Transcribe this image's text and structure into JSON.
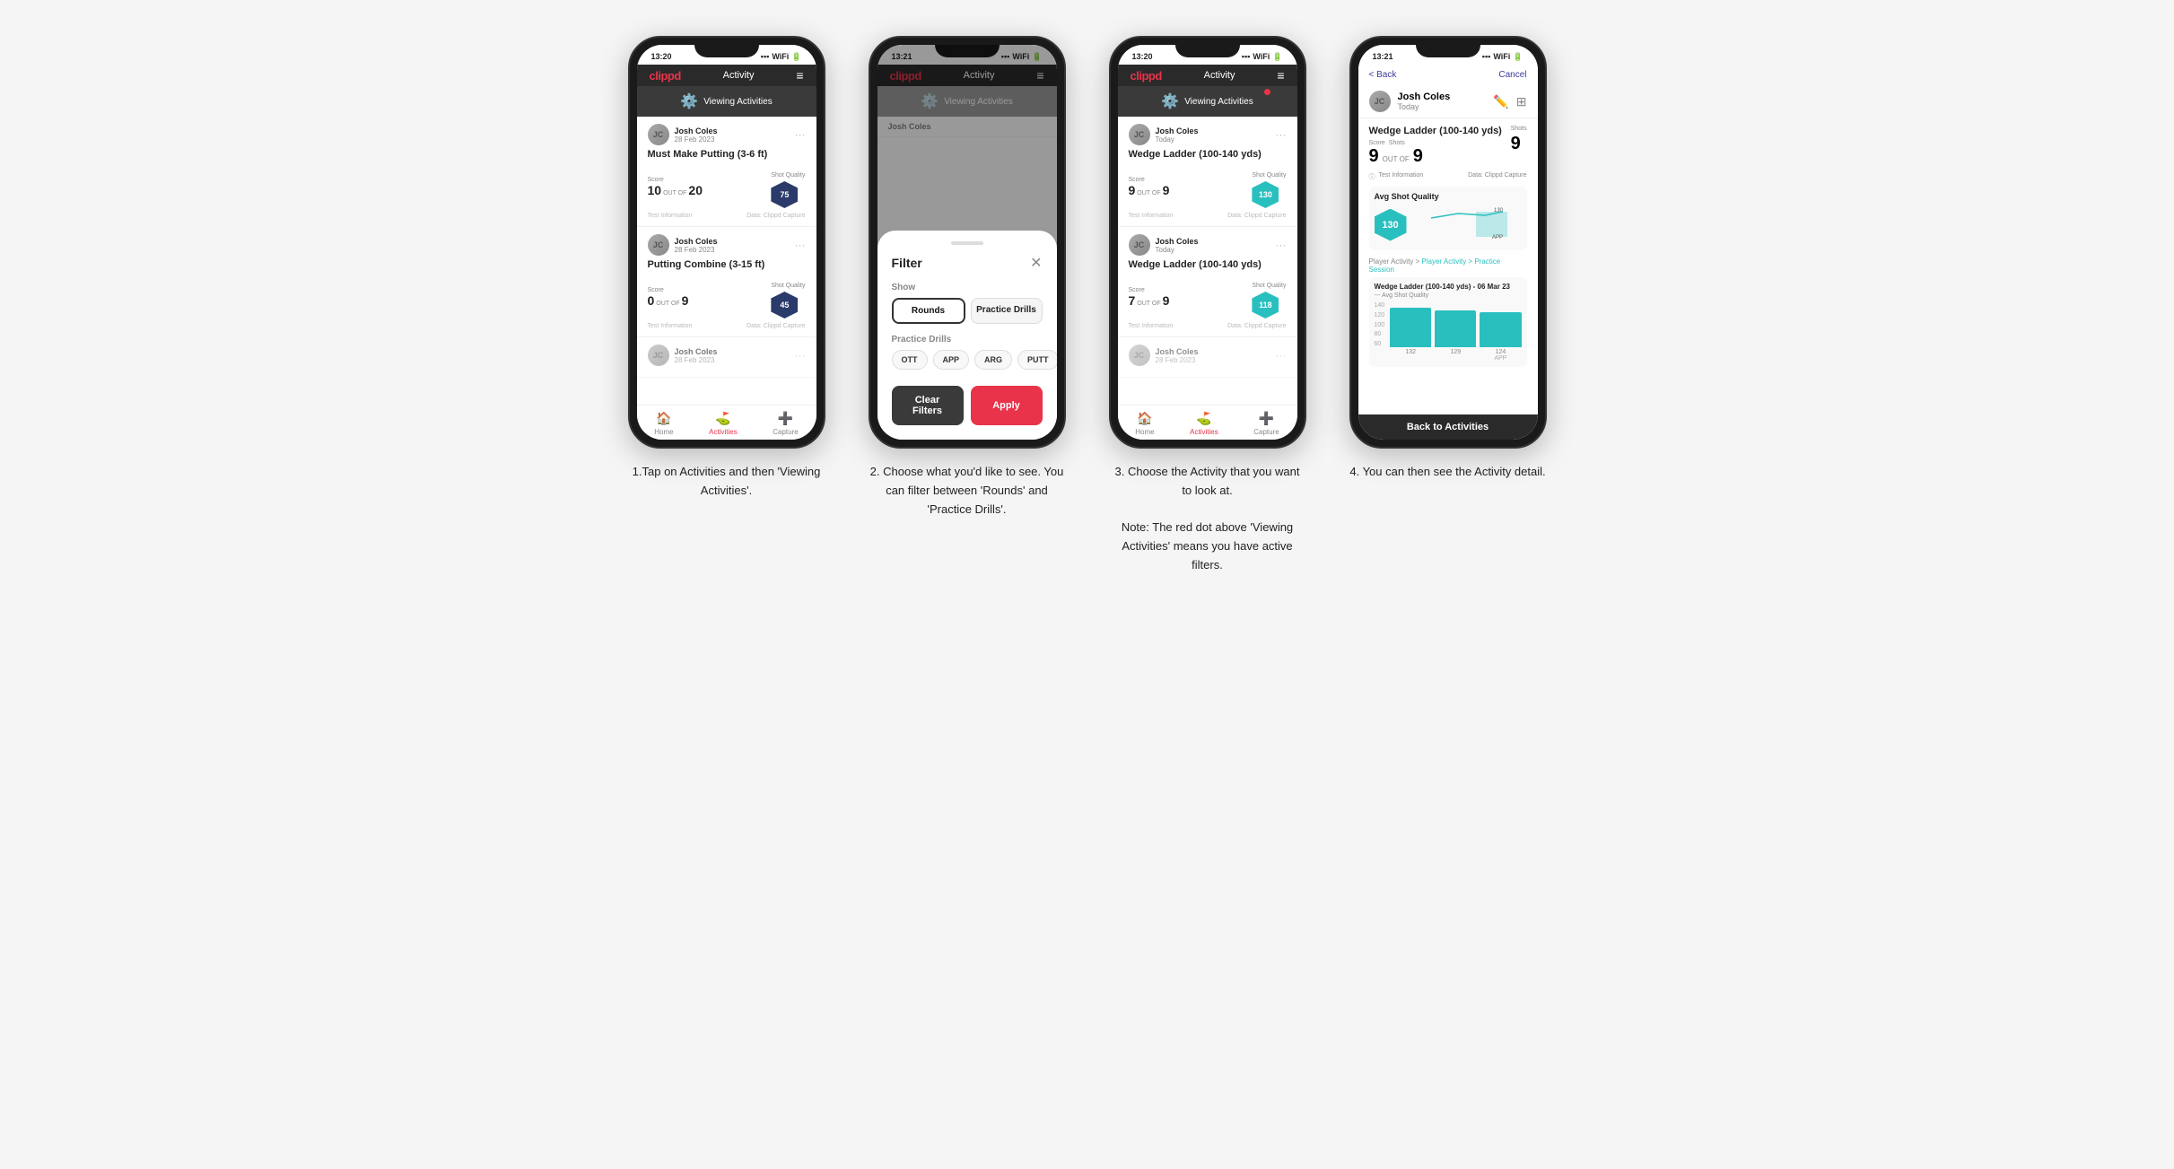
{
  "phones": [
    {
      "id": "phone1",
      "status_time": "13:20",
      "nav_title": "Activity",
      "viewing_activities_label": "Viewing Activities",
      "has_red_dot": false,
      "cards": [
        {
          "user_name": "Josh Coles",
          "user_date": "28 Feb 2023",
          "title": "Must Make Putting (3-6 ft)",
          "score_label": "Score",
          "shots_label": "Shots",
          "shot_quality_label": "Shot Quality",
          "score": "10",
          "out_of": "OUT OF",
          "shots": "20",
          "shot_quality": "75",
          "footer_left": "Test Information",
          "footer_right": "Data: Clippd Capture"
        },
        {
          "user_name": "Josh Coles",
          "user_date": "28 Feb 2023",
          "title": "Putting Combine (3-15 ft)",
          "score_label": "Score",
          "shots_label": "Shots",
          "shot_quality_label": "Shot Quality",
          "score": "0",
          "out_of": "OUT OF",
          "shots": "9",
          "shot_quality": "45",
          "footer_left": "Test Information",
          "footer_right": "Data: Clippd Capture"
        },
        {
          "user_name": "Josh Coles",
          "user_date": "28 Feb 2023",
          "title": "",
          "score": "",
          "shots": "",
          "shot_quality": ""
        }
      ],
      "bottom_nav": [
        "Home",
        "Activities",
        "Capture"
      ]
    },
    {
      "id": "phone2",
      "status_time": "13:21",
      "nav_title": "Activity",
      "viewing_activities_label": "Viewing Activities",
      "has_red_dot": false,
      "filter_title": "Filter",
      "filter_show_label": "Show",
      "filter_rounds": "Rounds",
      "filter_practice_drills": "Practice Drills",
      "filter_practice_drills_label": "Practice Drills",
      "filter_chips": [
        "OTT",
        "APP",
        "ARG",
        "PUTT"
      ],
      "btn_clear": "Clear Filters",
      "btn_apply": "Apply",
      "bottom_nav": [
        "Home",
        "Activities",
        "Capture"
      ]
    },
    {
      "id": "phone3",
      "status_time": "13:20",
      "nav_title": "Activity",
      "viewing_activities_label": "Viewing Activities",
      "has_red_dot": true,
      "cards": [
        {
          "user_name": "Josh Coles",
          "user_date": "Today",
          "title": "Wedge Ladder (100-140 yds)",
          "score_label": "Score",
          "shots_label": "Shots",
          "shot_quality_label": "Shot Quality",
          "score": "9",
          "out_of": "OUT OF",
          "shots": "9",
          "shot_quality": "130",
          "shot_quality_teal": true,
          "footer_left": "Test Information",
          "footer_right": "Data: Clippd Capture"
        },
        {
          "user_name": "Josh Coles",
          "user_date": "Today",
          "title": "Wedge Ladder (100-140 yds)",
          "score_label": "Score",
          "shots_label": "Shots",
          "shot_quality_label": "Shot Quality",
          "score": "7",
          "out_of": "OUT OF",
          "shots": "9",
          "shot_quality": "118",
          "shot_quality_teal": true,
          "footer_left": "Test Information",
          "footer_right": "Data: Clippd Capture"
        },
        {
          "user_name": "Josh Coles",
          "user_date": "28 Feb 2023",
          "title": "",
          "score": "",
          "shots": "",
          "shot_quality": ""
        }
      ],
      "bottom_nav": [
        "Home",
        "Activities",
        "Capture"
      ]
    },
    {
      "id": "phone4",
      "status_time": "13:21",
      "back_label": "< Back",
      "cancel_label": "Cancel",
      "user_name": "Josh Coles",
      "user_date": "Today",
      "detail_title": "Wedge Ladder (100-140 yds)",
      "score_label": "Score",
      "shots_label": "Shots",
      "score": "9",
      "out_of": "OUT OF",
      "shots": "9",
      "shot_quality": "130",
      "avg_shot_quality_label": "Avg Shot Quality",
      "practice_session_label": "Player Activity > Practice Session",
      "chart_title": "Wedge Ladder (100-140 yds) - 06 Mar 23",
      "chart_subtitle": "--- Avg Shot Quality",
      "chart_bars": [
        132,
        129,
        124
      ],
      "chart_y_labels": [
        "140",
        "120",
        "100",
        "80",
        "60"
      ],
      "chart_x_labels": [
        "",
        "",
        "APP"
      ],
      "back_to_activities": "Back to Activities",
      "test_info": "Test Information",
      "data_capture": "Data: Clippd Capture"
    }
  ],
  "descriptions": [
    {
      "text": "1.Tap on Activities and then 'Viewing Activities'."
    },
    {
      "text": "2. Choose what you'd like to see. You can filter between 'Rounds' and 'Practice Drills'."
    },
    {
      "text": "3. Choose the Activity that you want to look at.\n\nNote: The red dot above 'Viewing Activities' means you have active filters."
    },
    {
      "text": "4. You can then see the Activity detail."
    }
  ],
  "colors": {
    "brand_red": "#e8334a",
    "teal": "#2abfbf",
    "dark_nav": "#2a2a2a",
    "dark_card": "#3a3a3a"
  }
}
